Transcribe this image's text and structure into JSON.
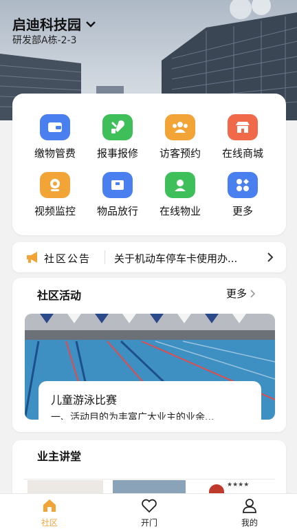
{
  "header": {
    "title": "启迪科技园",
    "subtitle": "研发部A栋-2-3"
  },
  "services": [
    {
      "label": "缴物管费",
      "icon": "wallet-icon",
      "color": "#4a7ff0"
    },
    {
      "label": "报事报修",
      "icon": "tools-icon",
      "color": "#3fbf5a"
    },
    {
      "label": "访客预约",
      "icon": "visitors-icon",
      "color": "#f2a436"
    },
    {
      "label": "在线商城",
      "icon": "store-icon",
      "color": "#f06a4a"
    },
    {
      "label": "视频监控",
      "icon": "camera-icon",
      "color": "#f2a436"
    },
    {
      "label": "物品放行",
      "icon": "package-icon",
      "color": "#4a7ff0"
    },
    {
      "label": "在线物业",
      "icon": "support-icon",
      "color": "#3fbf5a"
    },
    {
      "label": "更多",
      "icon": "more-apps-icon",
      "color": "#4a7ff0"
    }
  ],
  "notice": {
    "label": "社区公告",
    "text": "关于机动车停车卡使用办..."
  },
  "activity": {
    "title": "社区活动",
    "more": "更多",
    "event_title": "儿童游泳比赛",
    "event_desc": "一、活动目的为丰富广大业主的业余..."
  },
  "lecture": {
    "title": "业主讲堂"
  },
  "tabs": [
    {
      "label": "社区",
      "icon": "home-icon",
      "active": true
    },
    {
      "label": "开门",
      "icon": "heart-icon",
      "active": false
    },
    {
      "label": "我的",
      "icon": "user-icon",
      "active": false
    }
  ],
  "colors": {
    "accent": "#f2a436",
    "notice_icon": "#f2a436"
  }
}
